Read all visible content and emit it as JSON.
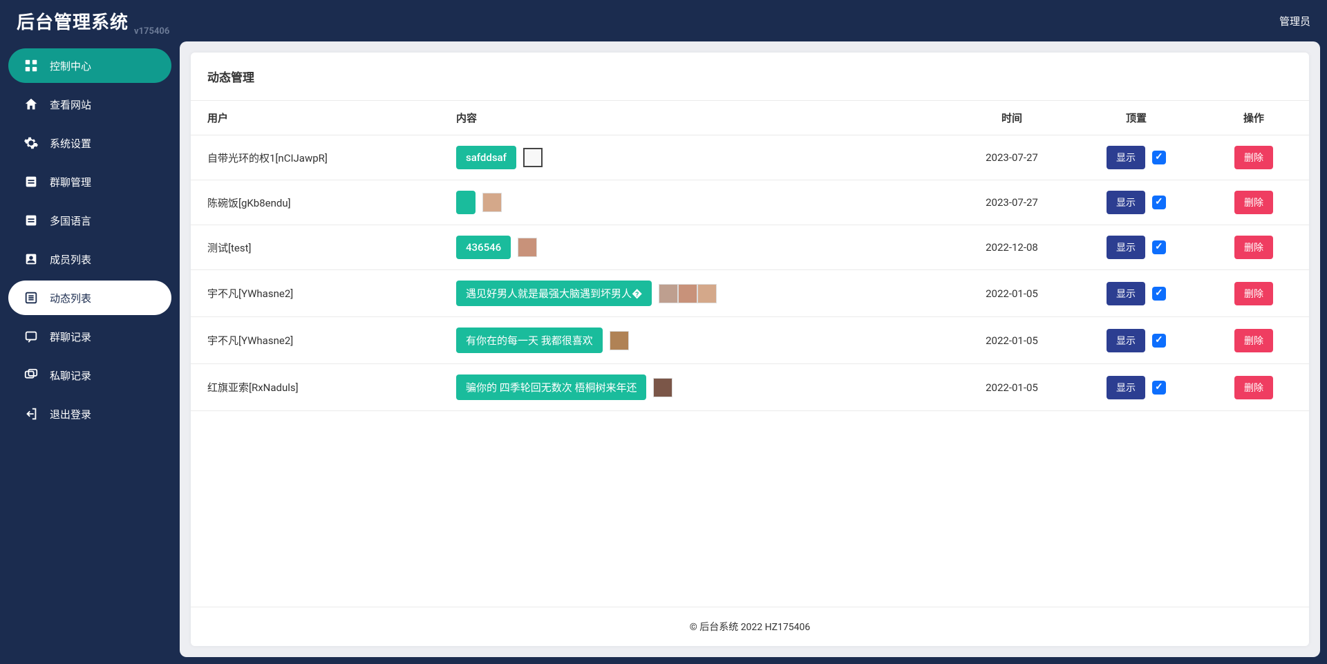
{
  "header": {
    "title": "后台管理系统",
    "version": "v175406",
    "user": "管理员"
  },
  "nav": [
    {
      "label": "控制中心",
      "icon": "dashboard",
      "active": "teal"
    },
    {
      "label": "查看网站",
      "icon": "home"
    },
    {
      "label": "系统设置",
      "icon": "gear"
    },
    {
      "label": "群聊管理",
      "icon": "doc"
    },
    {
      "label": "多国语言",
      "icon": "doc"
    },
    {
      "label": "成员列表",
      "icon": "users"
    },
    {
      "label": "动态列表",
      "icon": "list",
      "active": "white"
    },
    {
      "label": "群聊记录",
      "icon": "chat"
    },
    {
      "label": "私聊记录",
      "icon": "chat2"
    },
    {
      "label": "退出登录",
      "icon": "logout"
    }
  ],
  "page": {
    "title": "动态管理"
  },
  "table": {
    "headers": {
      "user": "用户",
      "content": "内容",
      "time": "时间",
      "pin": "顶置",
      "op": "操作"
    },
    "show_label": "显示",
    "delete_label": "删除",
    "rows": [
      {
        "user": "自带光环的权1[nCIJawpR]",
        "content": "safddsaf",
        "time": "2023-07-27",
        "pinned": true,
        "thumbs": [
          "t1"
        ]
      },
      {
        "user": "陈碗饭[gKb8endu]",
        "content": "",
        "time": "2023-07-27",
        "pinned": true,
        "thumbs": [
          "t2"
        ]
      },
      {
        "user": "测试[test]",
        "content": "436546",
        "time": "2022-12-08",
        "pinned": true,
        "thumbs": [
          "t3"
        ]
      },
      {
        "user": "宇不凡[YWhasne2]",
        "content": "遇见好男人就是最强大脑遇到坏男人�",
        "time": "2022-01-05",
        "pinned": true,
        "thumbs": [
          "t4",
          "t3",
          "t2"
        ]
      },
      {
        "user": "宇不凡[YWhasne2]",
        "content": "有你在的每一天 我都很喜欢",
        "time": "2022-01-05",
        "pinned": true,
        "thumbs": [
          "t5"
        ]
      },
      {
        "user": "红旗亚索[RxNaduls]",
        "content": "骗你的 四季轮回无数次 梧桐树来年还",
        "time": "2022-01-05",
        "pinned": true,
        "thumbs": [
          "t6"
        ]
      }
    ]
  },
  "footer": "© 后台系统 2022 HZ175406"
}
